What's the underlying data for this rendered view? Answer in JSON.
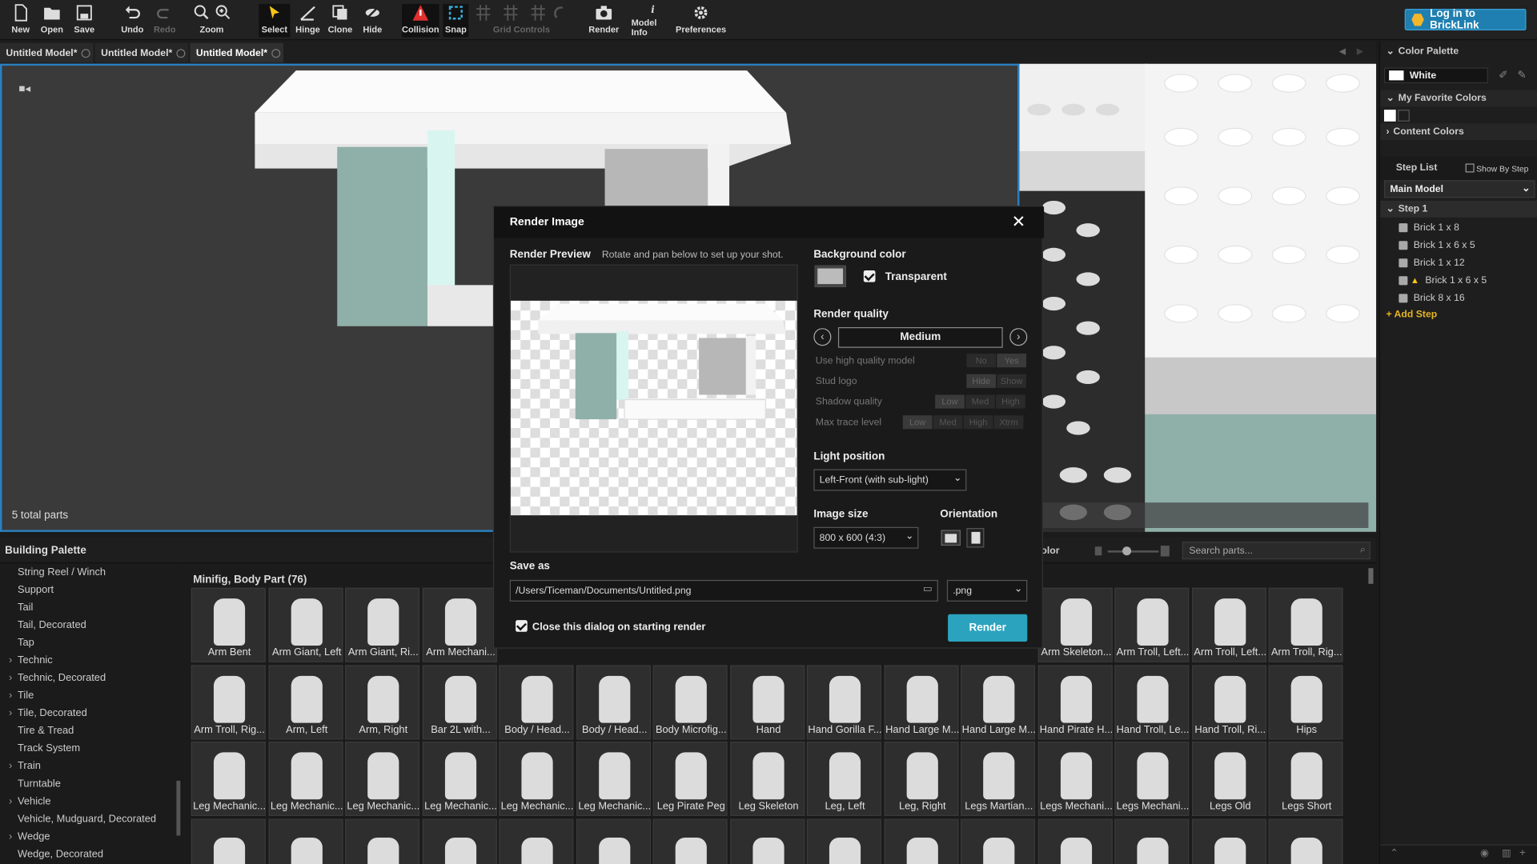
{
  "toolbar": {
    "items": [
      {
        "label": "New",
        "icon": "new-icon"
      },
      {
        "label": "Open",
        "icon": "open-icon"
      },
      {
        "label": "Save",
        "icon": "save-icon"
      },
      {
        "label": "Undo",
        "icon": "undo-icon"
      },
      {
        "label": "Redo",
        "icon": "redo-icon"
      },
      {
        "label": "Zoom",
        "icon": "zoom-icon"
      },
      {
        "label": "Select",
        "icon": "select-icon"
      },
      {
        "label": "Hinge",
        "icon": "hinge-icon"
      },
      {
        "label": "Clone",
        "icon": "clone-icon"
      },
      {
        "label": "Hide",
        "icon": "hide-icon"
      },
      {
        "label": "Collision",
        "icon": "collision-icon"
      },
      {
        "label": "Snap",
        "icon": "snap-icon"
      },
      {
        "label": "Grid Controls",
        "icon": "grid-icon"
      },
      {
        "label": "Render",
        "icon": "camera-icon"
      },
      {
        "label": "Model Info",
        "icon": "info-icon"
      },
      {
        "label": "Preferences",
        "icon": "gear-icon"
      }
    ],
    "login_label": "Log in to BrickLink"
  },
  "tabs": [
    "Untitled Model*",
    "Untitled Model*",
    "Untitled Model*"
  ],
  "viewport": {
    "parts_count": "5 total parts"
  },
  "right_panel": {
    "color_palette": "Color Palette",
    "current_color": "White",
    "favorites": "My Favorite Colors",
    "content_colors": "Content Colors",
    "step_list": "Step List",
    "show_by_step": "Show By Step",
    "model": "Main Model",
    "step": "Step 1",
    "steps": [
      "Brick 1 x 8",
      "Brick 1 x 6 x 5",
      "Brick 1 x 12",
      "Brick 1 x 6 x 5",
      "Brick 8 x 16"
    ],
    "add_step": "+ Add Step"
  },
  "palette": {
    "title": "Building Palette",
    "category_title": "Minifig, Body Part (76)",
    "search_placeholder": "Search parts...",
    "color_label": "olor",
    "categories": [
      "String Reel / Winch",
      "Support",
      "Tail",
      "Tail, Decorated",
      "Tap",
      "Technic",
      "Technic, Decorated",
      "Tile",
      "Tile, Decorated",
      "Tire & Tread",
      "Track System",
      "Train",
      "Turntable",
      "Vehicle",
      "Vehicle, Mudguard, Decorated",
      "Wedge",
      "Wedge, Decorated"
    ],
    "row1_left": [
      "Arm Bent",
      "Arm Giant, Left",
      "Arm Giant, Ri...",
      "Arm Mechani..."
    ],
    "row1_right": [
      "Arm Skeleton...",
      "Arm Troll, Left...",
      "Arm Troll, Left...",
      "Arm Troll, Rig..."
    ],
    "row2": [
      "Arm Troll, Rig...",
      "Arm, Left",
      "Arm, Right",
      "Bar   2L with...",
      "Body / Head...",
      "Body / Head...",
      "Body Microfig...",
      "Hand",
      "Hand Gorilla F...",
      "Hand Large M...",
      "Hand Large M...",
      "Hand Pirate H...",
      "Hand Troll, Le...",
      "Hand Troll, Ri...",
      "Hips"
    ],
    "row3": [
      "Leg Mechanic...",
      "Leg Mechanic...",
      "Leg Mechanic...",
      "Leg Mechanic...",
      "Leg Mechanic...",
      "Leg Mechanic...",
      "Leg Pirate Peg",
      "Leg Skeleton",
      "Leg, Left",
      "Leg, Right",
      "Legs Martian...",
      "Legs Mechani...",
      "Legs Mechani...",
      "Legs Old",
      "Legs Short"
    ]
  },
  "dialog": {
    "title": "Render Image",
    "preview_label": "Render Preview",
    "preview_hint": "Rotate and pan below to set up your shot.",
    "bg_color": "Background color",
    "transparent": "Transparent",
    "quality": "Render quality",
    "quality_value": "Medium",
    "opt1": "Use high quality model",
    "opt1_a": "No",
    "opt1_b": "Yes",
    "opt2": "Stud logo",
    "opt2_a": "Hide",
    "opt2_b": "Show",
    "opt3": "Shadow quality",
    "opt3_a": "Low",
    "opt3_b": "Med",
    "opt3_c": "High",
    "opt4": "Max trace level",
    "opt4_a": "Low",
    "opt4_b": "Med",
    "opt4_c": "High",
    "opt4_d": "Xtrm",
    "light": "Light position",
    "light_value": "Left-Front (with sub-light)",
    "image_size": "Image size",
    "image_size_value": "800 x 600 (4:3)",
    "orientation": "Orientation",
    "save_as": "Save as",
    "path": "/Users/Ticeman/Documents/Untitled.png",
    "ext": ".png",
    "close_on_start": "Close this dialog on starting render",
    "render_btn": "Render"
  }
}
